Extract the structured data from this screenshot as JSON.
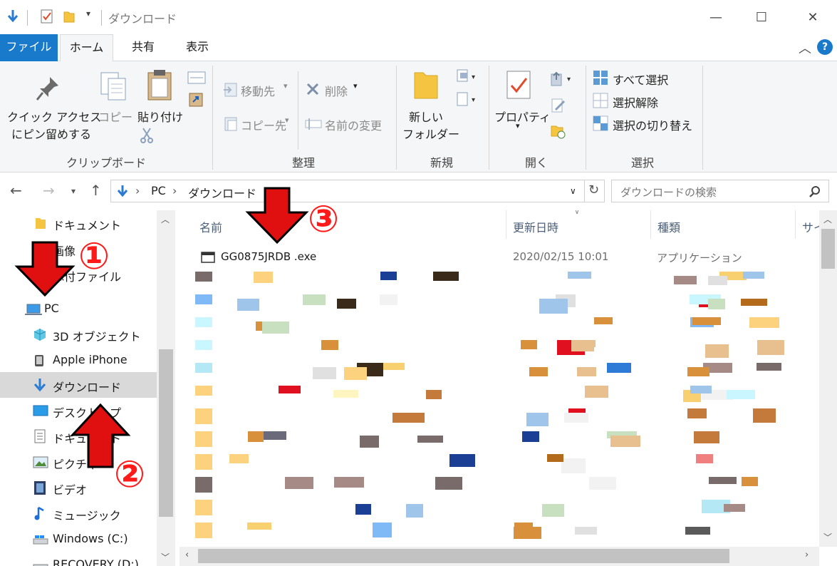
{
  "window": {
    "title": "ダウンロード",
    "minimize_glyph": "—",
    "maximize_glyph": "☐",
    "close_glyph": "✕"
  },
  "tabs": {
    "file": "ファイル",
    "home": "ホーム",
    "share": "共有",
    "view": "表示"
  },
  "ribbon": {
    "clipboard": {
      "pin_line1": "クイック アクセス",
      "pin_line2": "にピン留めする",
      "copy": "コピー",
      "paste": "貼り付け",
      "group": "クリップボード"
    },
    "organize": {
      "move_to": "移動先",
      "copy_to": "コピー先",
      "delete": "削除",
      "rename": "名前の変更",
      "group": "整理"
    },
    "new": {
      "folder_line1": "新しい",
      "folder_line2": "フォルダー",
      "group": "新規"
    },
    "open": {
      "properties": "プロパティ",
      "group": "開く"
    },
    "select": {
      "select_all": "すべて選択",
      "select_none": "選択解除",
      "invert": "選択の切り替え",
      "group": "選択"
    }
  },
  "address": {
    "segments": [
      "PC",
      "ダウンロード"
    ],
    "search_placeholder": "ダウンロードの検索"
  },
  "nav": {
    "items": [
      {
        "label": "ドキュメント",
        "icon": "folder-icon"
      },
      {
        "label": "画像",
        "icon": "folder-icon"
      },
      {
        "label": "添付ファイル",
        "icon": "folder-icon"
      },
      {
        "label": "PC",
        "icon": "pc-icon"
      },
      {
        "label": "3D オブジェクト",
        "icon": "3d-objects-icon"
      },
      {
        "label": "Apple iPhone",
        "icon": "phone-icon"
      },
      {
        "label": "ダウンロード",
        "icon": "download-icon"
      },
      {
        "label": "デスクトップ",
        "icon": "desktop-icon"
      },
      {
        "label": "ドキュメント",
        "icon": "documents-icon"
      },
      {
        "label": "ピクチャ",
        "icon": "pictures-icon"
      },
      {
        "label": "ビデオ",
        "icon": "video-icon"
      },
      {
        "label": "ミュージック",
        "icon": "music-icon"
      },
      {
        "label": "Windows (C:)",
        "icon": "drive-icon"
      },
      {
        "label": "RECOVERY (D:)",
        "icon": "drive-icon"
      }
    ]
  },
  "columns": {
    "name": "名前",
    "date": "更新日時",
    "type": "種類",
    "size": "サイ"
  },
  "files": [
    {
      "name": "GG0875JRDB .exe",
      "date": "2020/02/15 10:01",
      "type": "アプリケーション"
    }
  ],
  "annotations": {
    "one": "①",
    "two": "②",
    "three": "③"
  },
  "colors": {
    "accent": "#1979ca",
    "annotation_red": "#ff1a1a",
    "selected_nav": "#d9d9d9"
  }
}
